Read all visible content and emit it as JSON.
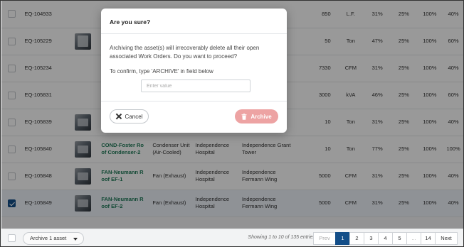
{
  "table": {
    "rows": [
      {
        "id": "EQ-104933",
        "thumb": false,
        "name": "",
        "type": "",
        "site": "",
        "building": "",
        "capacity": "850",
        "unit": "L.F.",
        "p1": "31%",
        "p2": "25%",
        "p3": "100%",
        "p4": "40%",
        "checked": false
      },
      {
        "id": "EQ-105229",
        "thumb": true,
        "name": "",
        "type": "",
        "site": "",
        "building": "",
        "capacity": "50",
        "unit": "Ton",
        "p1": "47%",
        "p2": "25%",
        "p3": "100%",
        "p4": "60%",
        "checked": false
      },
      {
        "id": "EQ-105234",
        "thumb": false,
        "name": "",
        "type": "",
        "site": "",
        "building": "",
        "capacity": "7330",
        "unit": "CFM",
        "p1": "31%",
        "p2": "25%",
        "p3": "100%",
        "p4": "40%",
        "checked": false
      },
      {
        "id": "EQ-105831",
        "thumb": false,
        "name": "",
        "type": "",
        "site": "",
        "building": "",
        "capacity": "3000",
        "unit": "kVA",
        "p1": "46%",
        "p2": "25%",
        "p3": "100%",
        "p4": "60%",
        "checked": false
      },
      {
        "id": "EQ-105839",
        "thumb": true,
        "name": "",
        "type": "Cooled)",
        "site": "Hospital",
        "building": "",
        "capacity": "10",
        "unit": "Ton",
        "p1": "31%",
        "p2": "25%",
        "p3": "100%",
        "p4": "40%",
        "checked": false
      },
      {
        "id": "EQ-105840",
        "thumb": true,
        "name": "COND-Foster Ro of Condenser-2",
        "type": "Condenser Unit (Air-Cooled)",
        "site": "Independence Hospital",
        "building": "Independence Grant Tower",
        "capacity": "10",
        "unit": "Ton",
        "p1": "77%",
        "p2": "25%",
        "p3": "100%",
        "p4": "100%",
        "checked": false
      },
      {
        "id": "EQ-105848",
        "thumb": true,
        "name": "FAN-Neumann R oof EF-1",
        "type": "Fan (Exhaust)",
        "site": "Independence Hospital",
        "building": "Independence Fermann Wing",
        "capacity": "5000",
        "unit": "CFM",
        "p1": "31%",
        "p2": "25%",
        "p3": "100%",
        "p4": "40%",
        "checked": false
      },
      {
        "id": "EQ-105849",
        "thumb": true,
        "name": "FAN-Neumann R oof EF-2",
        "type": "Fan (Exhaust)",
        "site": "Independence Hospital",
        "building": "Independence Fermann Wing",
        "capacity": "5000",
        "unit": "CFM",
        "p1": "31%",
        "p2": "25%",
        "p3": "100%",
        "p4": "40%",
        "checked": true
      }
    ]
  },
  "footer": {
    "bulk_action": "Archive 1 asset",
    "showing": "Showing 1 to 10 of 135 entries",
    "pager": {
      "prev": "Prev",
      "pages": [
        "1",
        "2",
        "3",
        "4",
        "5",
        "...",
        "14"
      ],
      "active": "1",
      "next": "Next"
    }
  },
  "modal": {
    "title": "Are you sure?",
    "message": "Archiving the asset(s) will irrecoverably delete all their open associated Work Orders. Do you want to proceed?",
    "confirm_label": "To confirm, type 'ARCHIVE' in field below",
    "input_placeholder": "Enter value",
    "input_value": "",
    "cancel_label": "Cancel",
    "archive_label": "Archive"
  },
  "colors": {
    "accent": "#134e88",
    "link": "#1f7a58",
    "archive_button": "#eda3a3"
  },
  "icons": {
    "cancel": "close-icon",
    "archive": "trash-icon",
    "bulk": "chevron-down-icon",
    "row_select": "checkbox-icon"
  }
}
